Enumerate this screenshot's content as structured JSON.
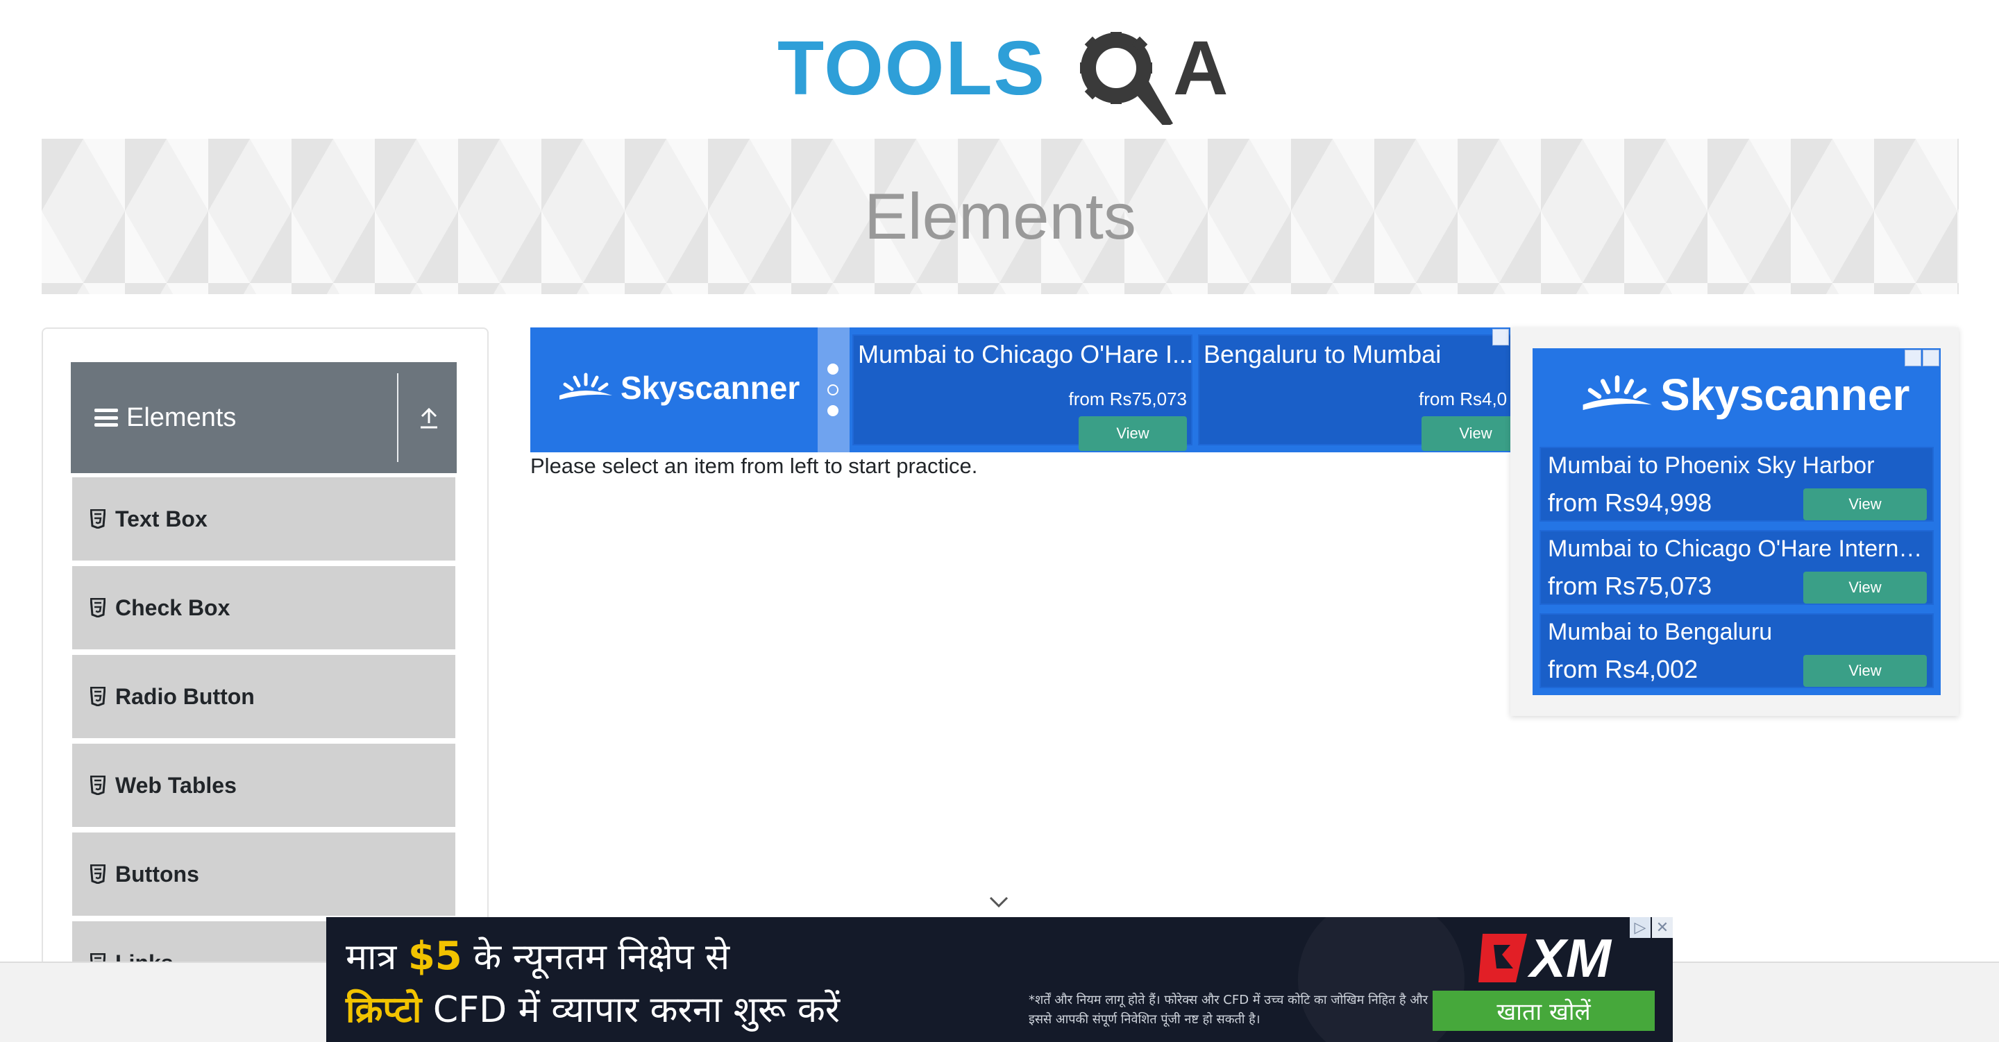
{
  "header": {
    "logo_text": "TOOLSQA"
  },
  "banner": {
    "title": "Elements"
  },
  "sidebar": {
    "group": {
      "label": "Elements"
    },
    "items": [
      {
        "label": "Text Box"
      },
      {
        "label": "Check Box"
      },
      {
        "label": "Radio Button"
      },
      {
        "label": "Web Tables"
      },
      {
        "label": "Buttons"
      },
      {
        "label": "Links"
      }
    ]
  },
  "main": {
    "prompt": "Please select an item from left to start practice."
  },
  "ad_top": {
    "brand": "Skyscanner",
    "cards": [
      {
        "route": "Mumbai to Chicago O'Hare I...",
        "price": "from Rs75,073",
        "view": "View"
      },
      {
        "route": "Bengaluru to Mumbai",
        "price": "from Rs4,0",
        "view": "View"
      }
    ]
  },
  "ad_right": {
    "brand": "Skyscanner",
    "cards": [
      {
        "route": "Mumbai to Phoenix Sky Harbor",
        "price": "from Rs94,998",
        "view": "View"
      },
      {
        "route": "Mumbai to Chicago O'Hare Interna...",
        "price": "from Rs75,073",
        "view": "View"
      },
      {
        "route": "Mumbai to Bengaluru",
        "price": "from Rs4,002",
        "view": "View"
      }
    ]
  },
  "ad_bottom": {
    "line1_pre": "मात्र ",
    "line1_amount": "$5",
    "line1_post": " के न्यूनतम निक्षेप से",
    "line2_highlight": "क्रिप्टो",
    "line2_rest": " CFD में व्यापार करना शुरू करें",
    "disclaimer": "*शर्तें और नियम लागू होते हैं। फोरेक्स और CFD में उच्च कोटि का जोखिम निहित है और इससे आपकी संपूर्ण निवेशित पूंजी नष्ट हो सकती है।",
    "cta": "खाता खोलें",
    "brand": "XM",
    "close": "✕"
  },
  "colors": {
    "sidebar_header": "#6c757d",
    "menu_item": "#d1d1d1",
    "skyscanner_blue": "#2475e5",
    "view_button": "#3a9f87",
    "xm_cta": "#46a83b",
    "xm_red": "#e21f26"
  }
}
